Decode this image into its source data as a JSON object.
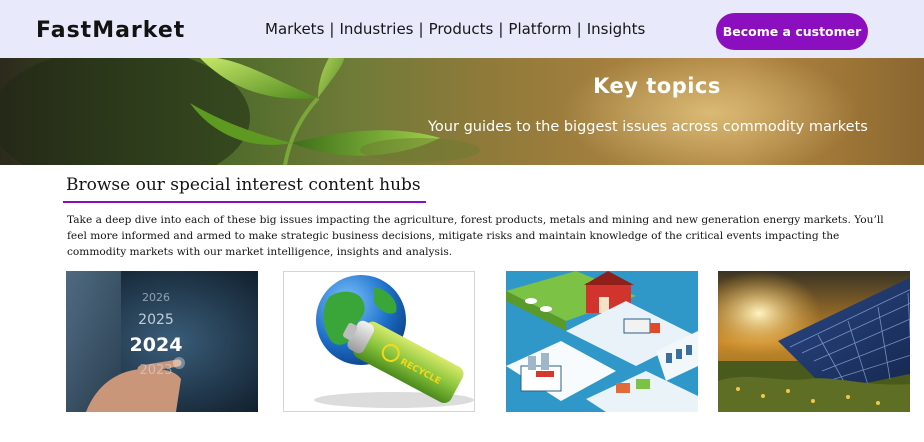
{
  "header": {
    "logo": "FastMarket",
    "nav": [
      "Markets",
      "Industries",
      "Products",
      "Platform",
      "Insights"
    ],
    "nav_separator": "|",
    "cta_label": "Become a customer"
  },
  "hero": {
    "title": "Key topics",
    "subtitle": "Your guides to the biggest issues across commodity markets"
  },
  "section": {
    "title": "Browse our special interest content hubs",
    "intro": "Take a deep dive into each of these big issues impacting the agriculture, forest products, metals and mining and new generation energy markets. You’ll feel more informed and armed to make strategic business decisions, mitigate risks and maintain knowledge of the critical events impacting the commodity markets with our market intelligence, insights and analysis."
  },
  "cards": [
    {
      "image": "years-2024-touch-image",
      "years": [
        "2026",
        "2025",
        "2024",
        "2023"
      ]
    },
    {
      "image": "globe-battery-recycle-image",
      "battery_text": "RECYCLE"
    },
    {
      "image": "farm-to-factory-supply-chain-image"
    },
    {
      "image": "solar-panels-field-image"
    }
  ],
  "colors": {
    "accent": "#8c0fbf",
    "header_bg": "#e8eafc"
  }
}
